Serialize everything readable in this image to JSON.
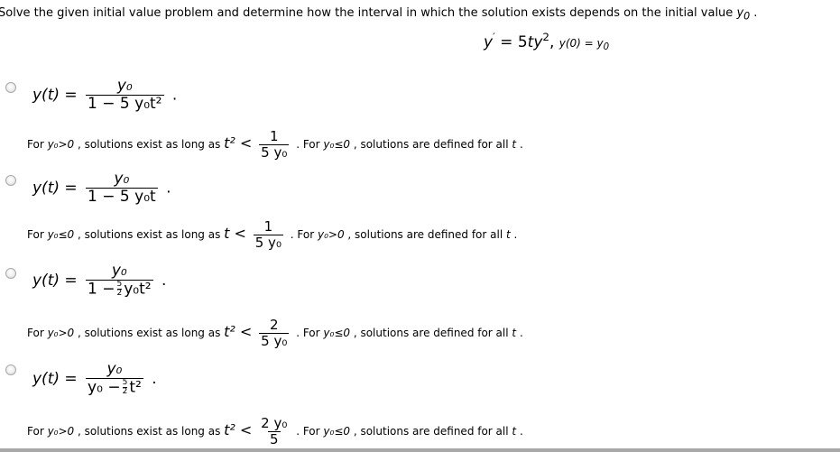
{
  "question": {
    "prompt": "Solve the given initial value problem and determine how the interval in which the solution exists depends on the initial value",
    "prompt_var": "y",
    "prompt_var_sub": "0",
    "prompt_end": " .",
    "ode": {
      "lhs": "y",
      "prime": "′",
      "eq": " = 5",
      "t": "t",
      "y": "y",
      "exp": "2",
      "comma": ", ",
      "ic": "y(0) = y",
      "ic_sub": "0"
    }
  },
  "options": [
    {
      "lhs": "y(t) =",
      "num": "y₀",
      "den": "1 − 5 y₀t²",
      "den_has_half": false,
      "period": ".",
      "note": {
        "pre": "For ",
        "cond": "y₀>0",
        "mid": " , solutions exist as long as ",
        "ineq_lhs": "t² <",
        "ineq_num": "1",
        "ineq_den": "5 y₀",
        "dot": " . ",
        "pre2": "For ",
        "cond2": "y₀≤0",
        "post": " , solutions are defined for all ",
        "t": "t",
        "end": " ."
      }
    },
    {
      "lhs": "y(t) =",
      "num": "y₀",
      "den": "1 − 5 y₀t",
      "den_has_half": false,
      "period": ".",
      "note": {
        "pre": "For ",
        "cond": "y₀≤0",
        "mid": " , solutions exist as long as ",
        "ineq_lhs": "t <",
        "ineq_num": "1",
        "ineq_den": "5 y₀",
        "dot": " . ",
        "pre2": "For ",
        "cond2": "y₀>0",
        "post": " , solutions are defined for all ",
        "t": "t",
        "end": " ."
      }
    },
    {
      "lhs": "y(t) =",
      "num": "y₀",
      "den_a": "1 −",
      "half_num": "5",
      "half_den": "2",
      "den_b": "y₀t²",
      "den_has_half": true,
      "period": ".",
      "note": {
        "pre": "For ",
        "cond": "y₀>0",
        "mid": " , solutions exist as long as ",
        "ineq_lhs": "t² <",
        "ineq_num": "2",
        "ineq_den": "5 y₀",
        "dot": " . ",
        "pre2": "For ",
        "cond2": "y₀≤0",
        "post": " , solutions are defined for all ",
        "t": "t",
        "end": " ."
      }
    },
    {
      "lhs": "y(t) =",
      "num": "y₀",
      "den_a": "y₀ −",
      "half_num": "5",
      "half_den": "2",
      "den_b": "t²",
      "den_has_half": true,
      "period": ".",
      "note": {
        "pre": "For ",
        "cond": "y₀>0",
        "mid": " , solutions exist as long as ",
        "ineq_lhs": "t² <",
        "ineq_num": "2 y₀",
        "ineq_den": "5",
        "dot": " . ",
        "pre2": "For ",
        "cond2": "y₀≤0",
        "post": " , solutions are defined for all ",
        "t": "t",
        "end": " ."
      }
    }
  ]
}
